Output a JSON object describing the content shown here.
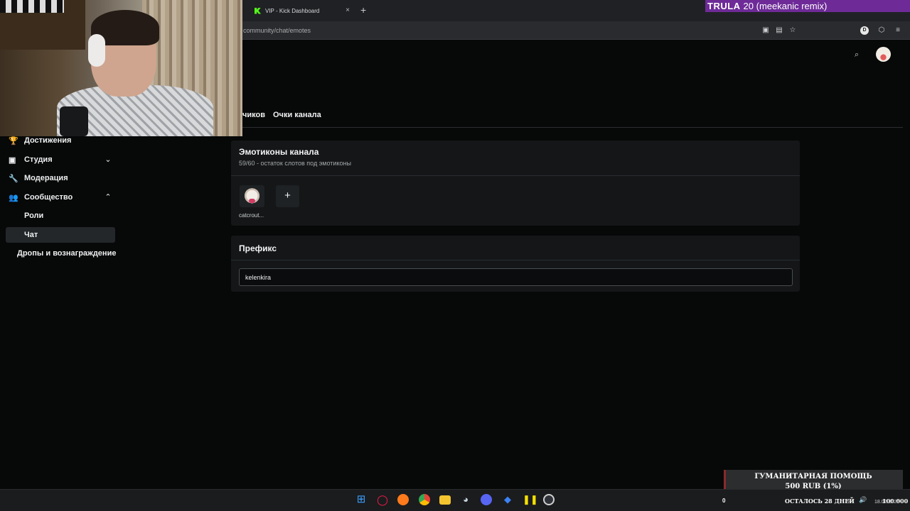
{
  "browser": {
    "tab_title": "VIP - Kick Dashboard",
    "tab_close": "×",
    "new_tab": "+",
    "url": "community/chat/emotes"
  },
  "now_playing": {
    "artist": "TRULA",
    "track": "20 (meekanic remix)"
  },
  "dashboard_tabs": [
    "чиков",
    "Очки канала"
  ],
  "sidebar": {
    "items": [
      {
        "label": "Достижения",
        "icon": "trophy-icon"
      },
      {
        "label": "Студия",
        "icon": "studio-icon"
      },
      {
        "label": "Модерация",
        "icon": "wrench-icon"
      },
      {
        "label": "Сообщество",
        "icon": "community-icon"
      }
    ],
    "community_sub": [
      "Роли",
      "Чат"
    ],
    "drops_label": "Дропы и вознаграждение"
  },
  "emotes": {
    "title": "Эмотиконы канала",
    "subtitle": "59/60 - остаток слотов под эмотиконы",
    "emote_name": "catcrout...",
    "add_label": "+"
  },
  "prefix": {
    "title": "Префикс",
    "value": "kelenkira"
  },
  "donation": {
    "title": "ГУМАНИТАРНАЯ ПОМОЩЬ",
    "amount": "500 RUB (1%)",
    "start": "0",
    "days_left": "ОСТАЛОСЬ 28 ДНЕЙ",
    "goal": "100 000"
  },
  "taskbar": {
    "date": "18.02.2025"
  },
  "colors": {
    "accent": "#53fc18",
    "music_bg": "#6e2b98",
    "card_bg": "#141617",
    "page_bg": "#070808"
  }
}
